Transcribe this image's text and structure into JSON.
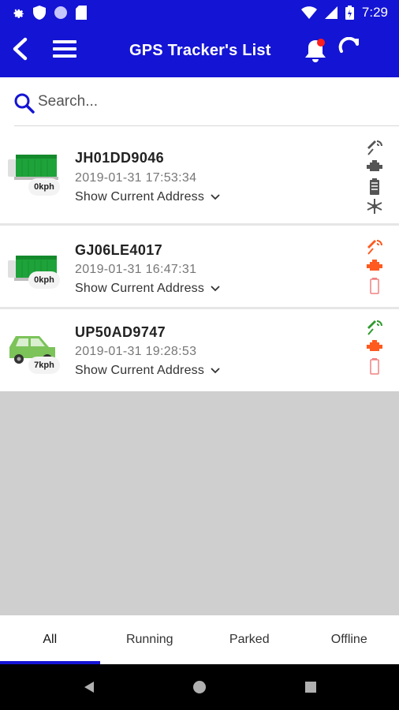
{
  "status_bar": {
    "time": "7:29",
    "icons": [
      "settings-icon",
      "shield-icon",
      "circle-icon",
      "sd-card-icon",
      "wifi-icon",
      "signal-icon",
      "battery-icon"
    ]
  },
  "app_bar": {
    "title": "GPS Tracker's List",
    "icons": [
      "back-arrow-icon",
      "menu-icon",
      "notification-bell-icon",
      "refresh-icon"
    ],
    "notification_dot_color": "#ff1d1d"
  },
  "search": {
    "placeholder": "Search..."
  },
  "trackers": [
    {
      "plate": "JH01DD9046",
      "timestamp": "2019-01-31 17:53:34",
      "address_label": "Show Current Address",
      "speed": "0kph",
      "vehicle_icon": "truck-icon",
      "status_icons": [
        "gps-icon",
        "engine-icon",
        "battery-icon",
        "ac-snowflake-icon"
      ],
      "status_color": "#555555"
    },
    {
      "plate": "GJ06LE4017",
      "timestamp": "2019-01-31 16:47:31",
      "address_label": "Show Current Address",
      "speed": "0kph",
      "vehicle_icon": "truck-icon",
      "status_icons": [
        "gps-icon",
        "engine-icon",
        "battery-icon"
      ],
      "status_color": "#ff5a1f"
    },
    {
      "plate": "UP50AD9747",
      "timestamp": "2019-01-31 19:28:53",
      "address_label": "Show Current Address",
      "speed": "7kph",
      "vehicle_icon": "car-icon",
      "status_icons": [
        "gps-icon",
        "engine-icon",
        "battery-icon"
      ],
      "status_color": "#2e9b2e"
    }
  ],
  "tabs": [
    {
      "label": "All",
      "active": true
    },
    {
      "label": "Running",
      "active": false
    },
    {
      "label": "Parked",
      "active": false
    },
    {
      "label": "Offline",
      "active": false
    }
  ],
  "colors": {
    "primary": "#1414d4",
    "truck_green": "#1ea33a",
    "car_green": "#7cc35a",
    "battery_red": "#f08080"
  }
}
